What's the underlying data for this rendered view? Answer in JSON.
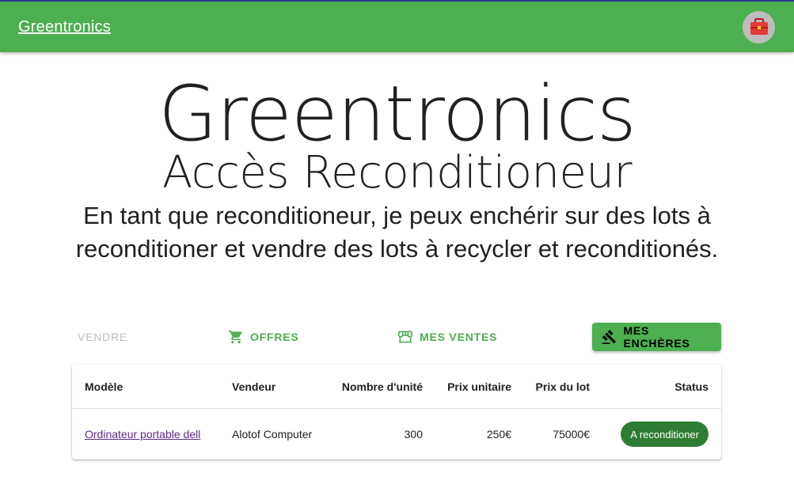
{
  "appbar": {
    "brand": "Greentronics",
    "avatar_icon": "toolbox-icon"
  },
  "hero": {
    "title": "Greentronics",
    "subtitle": "Accès Reconditioneur",
    "description": "En tant que reconditioneur, je peux enchérir sur des lots à reconditioner et vendre des lots à recycler et reconditionés."
  },
  "actions": {
    "sell": "VENDRE",
    "offers": "OFFRES",
    "my_sales": "MES VENTES",
    "my_bids": "MES ENCHÈRES"
  },
  "table": {
    "headers": [
      "Modèle",
      "Vendeur",
      "Nombre d'unité",
      "Prix unitaire",
      "Prix du lot",
      "Status"
    ],
    "rows": [
      {
        "model": "Ordinateur portable dell",
        "seller": "Alotof Computer",
        "units": "300",
        "unit_price": "250€",
        "lot_price": "75000€",
        "status": "A reconditioner"
      }
    ]
  },
  "colors": {
    "primary": "#4caf50",
    "status_chip": "#2e7d32",
    "link": "#5b2a86"
  }
}
